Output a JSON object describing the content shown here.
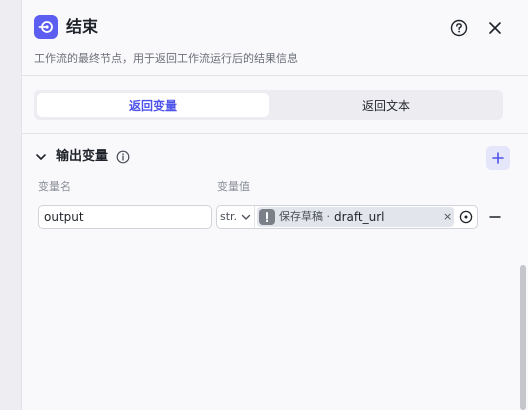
{
  "header": {
    "title": "结束",
    "description": "工作流的最终节点，用于返回工作流运行后的结果信息",
    "icon": "end-node-icon",
    "help_icon": "question-circle-icon",
    "close_icon": "close-icon",
    "accent": "#5b5ef0"
  },
  "tabs": [
    {
      "label": "返回变量",
      "active": true
    },
    {
      "label": "返回文本",
      "active": false
    }
  ],
  "output_section": {
    "title": "输出变量",
    "columns": {
      "name": "变量名",
      "value": "变量值"
    },
    "rows": [
      {
        "name": "output",
        "type": "str.",
        "reference_source": "保存草稿 ·",
        "reference_variable": "draft_url",
        "clear": "×"
      }
    ]
  }
}
